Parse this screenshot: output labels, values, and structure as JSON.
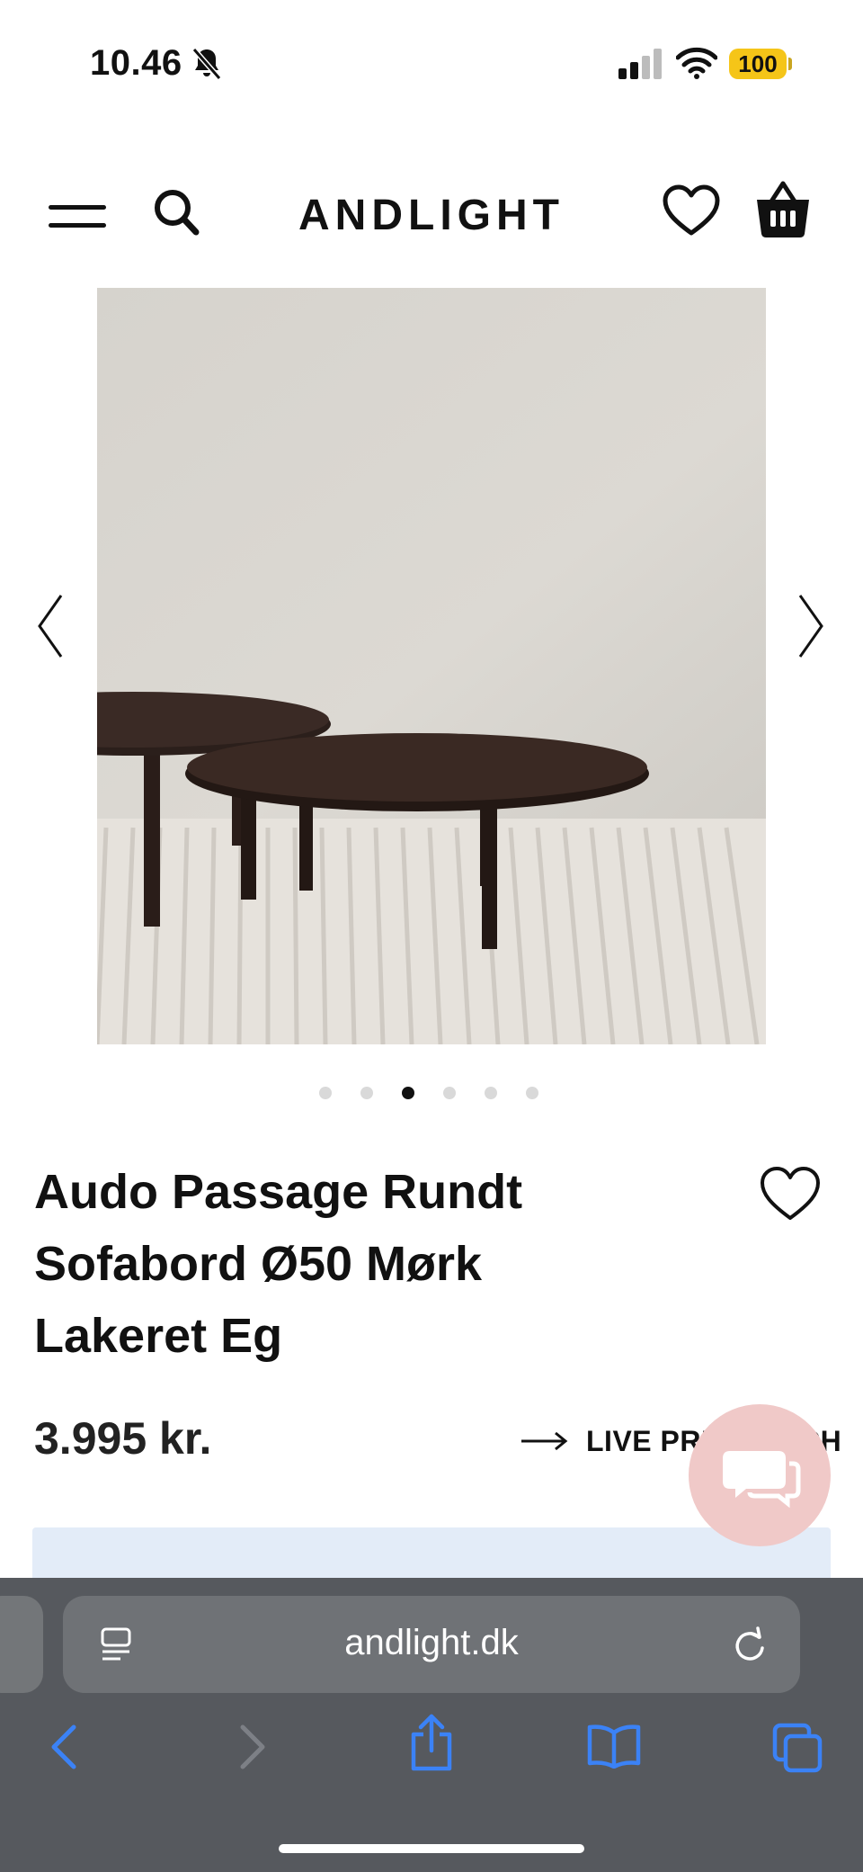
{
  "status_bar": {
    "time": "10.46",
    "battery": "100",
    "icons": [
      "bell-slash-icon",
      "signal-icon",
      "wifi-icon",
      "battery-icon"
    ],
    "battery_color": "#f5c518"
  },
  "header": {
    "brand": "ANDLIGHT",
    "icons": [
      "menu-icon",
      "search-icon",
      "heart-icon",
      "shopping-basket-icon"
    ]
  },
  "gallery": {
    "image_count": 6,
    "active_index": 2,
    "icons": [
      "chevron-left-icon",
      "chevron-right-icon"
    ]
  },
  "product": {
    "title": "Audo Passage Rundt Sofabord Ø50 Mørk Lakeret Eg",
    "price": "3.995 kr.",
    "live_price_label": "LIVE PRIS MATCH"
  },
  "chat": {
    "color": "#f0c9c8",
    "icon": "chat-icon"
  },
  "browser": {
    "url": "andlight.dk",
    "toolbar_icons": [
      "back-icon",
      "forward-icon",
      "share-icon",
      "bookmarks-icon",
      "tabs-icon"
    ],
    "accent": "#3b82f6"
  }
}
